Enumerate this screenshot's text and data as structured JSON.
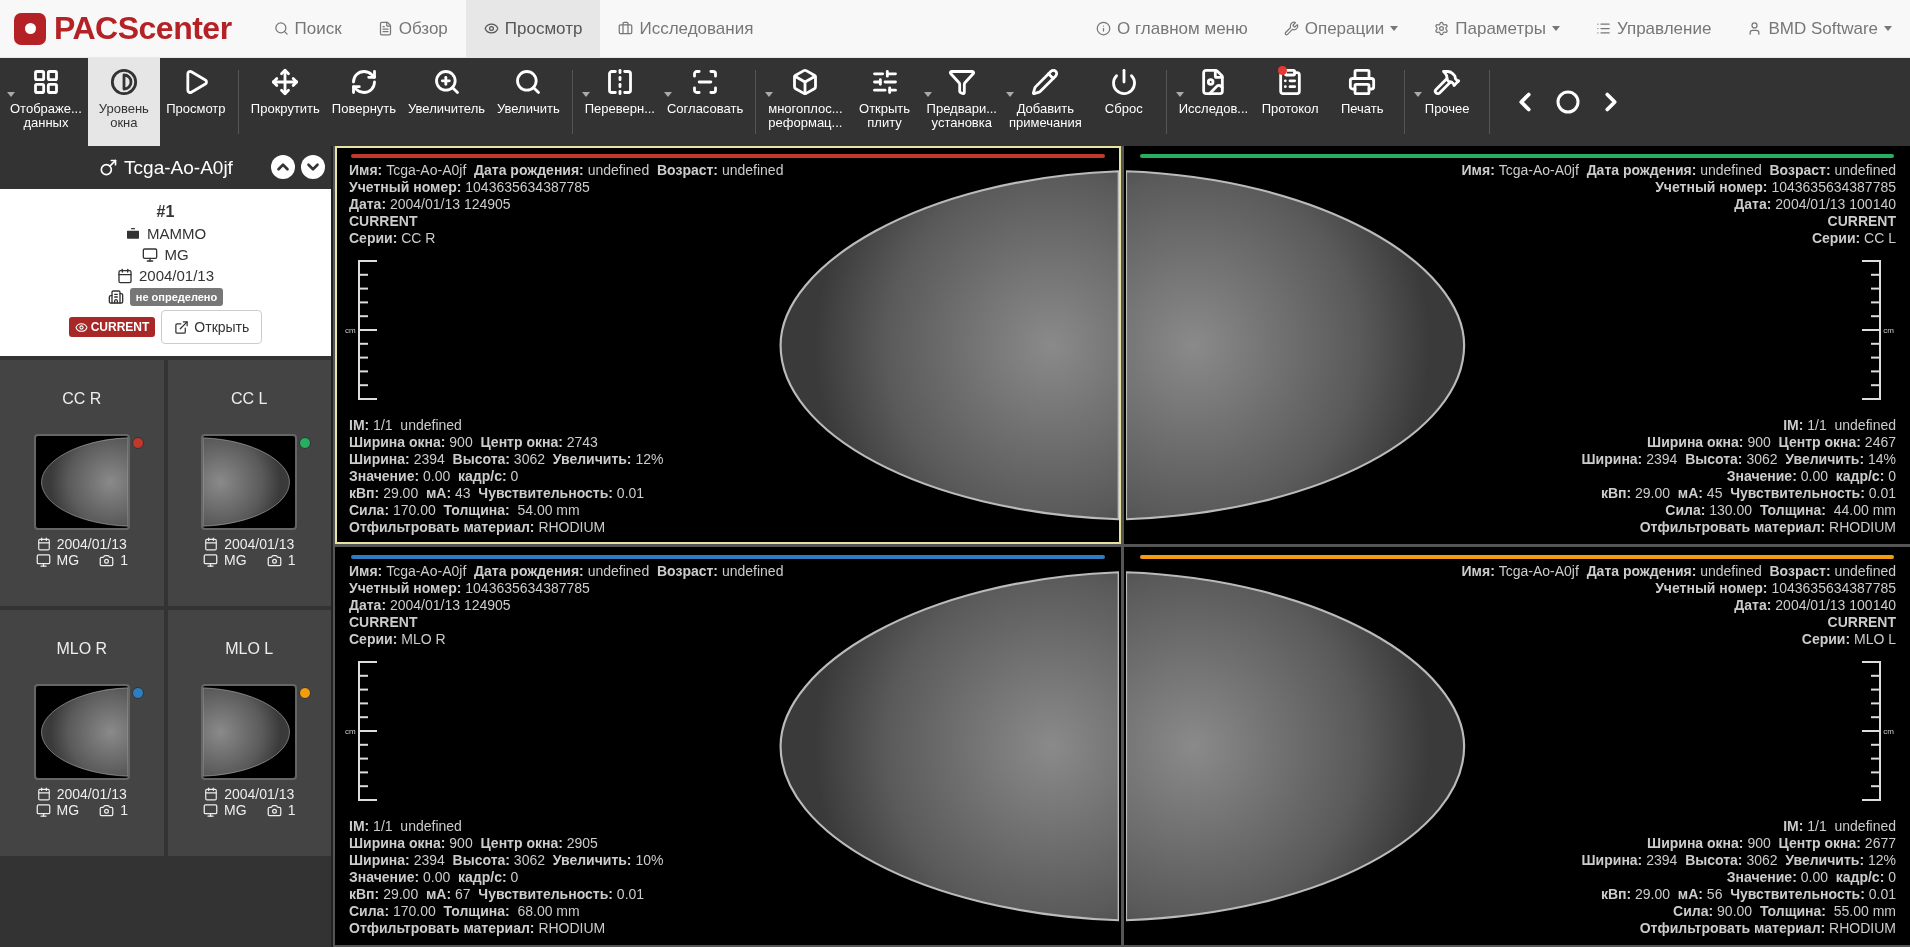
{
  "nav": {
    "logo": "PACScenter",
    "left": [
      {
        "label": "Поиск",
        "selected": false
      },
      {
        "label": "Обзор",
        "selected": false
      },
      {
        "label": "Просмотр",
        "selected": true
      },
      {
        "label": "Исследования",
        "selected": false
      }
    ],
    "right": [
      {
        "label": "О главном меню",
        "dropdown": false
      },
      {
        "label": "Операции",
        "dropdown": true
      },
      {
        "label": "Параметры",
        "dropdown": true
      },
      {
        "label": "Управление",
        "dropdown": false
      },
      {
        "label": "BMD Software",
        "dropdown": true
      }
    ]
  },
  "toolbar": {
    "groups": [
      [
        {
          "lines": [
            "Отображе...",
            "данных"
          ],
          "dropdown": true,
          "selected": false,
          "alert": false
        },
        {
          "lines": [
            "Уровень",
            "окна"
          ],
          "dropdown": false,
          "selected": true,
          "alert": false
        },
        {
          "lines": [
            "Просмотр"
          ],
          "dropdown": false,
          "selected": false,
          "alert": false
        }
      ],
      [
        {
          "lines": [
            "Прокрутить"
          ],
          "dropdown": false,
          "selected": false,
          "alert": false
        },
        {
          "lines": [
            "Повернуть"
          ],
          "dropdown": false,
          "selected": false,
          "alert": false
        },
        {
          "lines": [
            "Увеличитель"
          ],
          "dropdown": false,
          "selected": false,
          "alert": false
        },
        {
          "lines": [
            "Увеличить"
          ],
          "dropdown": false,
          "selected": false,
          "alert": false
        }
      ],
      [
        {
          "lines": [
            "Переверн..."
          ],
          "dropdown": true,
          "selected": false,
          "alert": false
        },
        {
          "lines": [
            "Согласовать"
          ],
          "dropdown": true,
          "selected": false,
          "alert": false
        }
      ],
      [
        {
          "lines": [
            "многоплос...",
            "реформац..."
          ],
          "dropdown": true,
          "selected": false,
          "alert": false
        },
        {
          "lines": [
            "Открыть",
            "плиту"
          ],
          "dropdown": false,
          "selected": false,
          "alert": false
        },
        {
          "lines": [
            "Предвари...",
            "установка"
          ],
          "dropdown": true,
          "selected": false,
          "alert": false
        },
        {
          "lines": [
            "Добавить",
            "примечания"
          ],
          "dropdown": true,
          "selected": false,
          "alert": false
        },
        {
          "lines": [
            "Сброс"
          ],
          "dropdown": false,
          "selected": false,
          "alert": false
        }
      ],
      [
        {
          "lines": [
            "Исследов..."
          ],
          "dropdown": true,
          "selected": false,
          "alert": false
        },
        {
          "lines": [
            "Протокол"
          ],
          "dropdown": false,
          "selected": false,
          "alert": true
        },
        {
          "lines": [
            "Печать"
          ],
          "dropdown": false,
          "selected": false,
          "alert": false
        }
      ],
      [
        {
          "lines": [
            "Прочее"
          ],
          "dropdown": true,
          "selected": false,
          "alert": false
        }
      ]
    ]
  },
  "patient": {
    "name": "Tcga-Ao-A0jf"
  },
  "study": {
    "number": "#1",
    "description": "MAMMO",
    "modality": "MG",
    "date": "2004/01/13",
    "institution": "не определено",
    "status": "CURRENT",
    "open_button": "Открыть"
  },
  "series": [
    {
      "title": "CC R",
      "color": "#c0392b",
      "date": "2004/01/13",
      "modality": "MG",
      "count": "1"
    },
    {
      "title": "CC L",
      "color": "#27ae60",
      "date": "2004/01/13",
      "modality": "MG",
      "count": "1"
    },
    {
      "title": "MLO R",
      "color": "#2e7dc0",
      "date": "2004/01/13",
      "modality": "MG",
      "count": "1"
    },
    {
      "title": "MLO L",
      "color": "#f39c12",
      "date": "2004/01/13",
      "modality": "MG",
      "count": "1"
    }
  ],
  "viewports": [
    {
      "selected": true,
      "color": "#c0392b",
      "ruler_unit": "cm",
      "top_lines": [
        "**Имя:** Tcga-Ao-A0jf  **Дата рождения:** undefined  **Возраст:** undefined",
        "**Учетный номер:** 1043635634387785",
        "**Дата:** 2004/01/13 124905",
        "**CURRENT**",
        "**Серии:** CC R"
      ],
      "bottom_lines": [
        "**IM:** 1/1  undefined",
        "**Ширина окна:** 900  **Центр окна:** 2743",
        "**Ширина:** 2394  **Высота:** 3062  **Увеличить:** 12%",
        "**Значение:** 0.00  **кадр/с:** 0",
        "**кВп:** 29.00  **мА:** 43  **Чувствительность:** 0.01",
        "**Сила:** 170.00  **Толщина:**  54.00 mm",
        "**Отфильтровать материал:** RHODIUM"
      ]
    },
    {
      "selected": false,
      "color": "#27ae60",
      "ruler_unit": "cm",
      "top_lines": [
        "**Имя:** Tcga-Ao-A0jf  **Дата рождения:** undefined  **Возраст:** undefined",
        "**Учетный номер:** 1043635634387785",
        "**Дата:** 2004/01/13 100140",
        "**CURRENT**",
        "**Серии:** CC L"
      ],
      "bottom_lines": [
        "**IM:** 1/1  undefined",
        "**Ширина окна:** 900  **Центр окна:** 2467",
        "**Ширина:** 2394  **Высота:** 3062  **Увеличить:** 14%",
        "**Значение:** 0.00  **кадр/с:** 0",
        "**кВп:** 29.00  **мА:** 45  **Чувствительность:** 0.01",
        "**Сила:** 130.00  **Толщина:**  44.00 mm",
        "**Отфильтровать материал:** RHODIUM"
      ]
    },
    {
      "selected": false,
      "color": "#2e7dc0",
      "ruler_unit": "cm",
      "top_lines": [
        "**Имя:** Tcga-Ao-A0jf  **Дата рождения:** undefined  **Возраст:** undefined",
        "**Учетный номер:** 1043635634387785",
        "**Дата:** 2004/01/13 124905",
        "**CURRENT**",
        "**Серии:** MLO R"
      ],
      "bottom_lines": [
        "**IM:** 1/1  undefined",
        "**Ширина окна:** 900  **Центр окна:** 2905",
        "**Ширина:** 2394  **Высота:** 3062  **Увеличить:** 10%",
        "**Значение:** 0.00  **кадр/с:** 0",
        "**кВп:** 29.00  **мА:** 67  **Чувствительность:** 0.01",
        "**Сила:** 170.00  **Толщина:**  68.00 mm",
        "**Отфильтровать материал:** RHODIUM"
      ]
    },
    {
      "selected": false,
      "color": "#f39c12",
      "ruler_unit": "cm",
      "top_lines": [
        "**Имя:** Tcga-Ao-A0jf  **Дата рождения:** undefined  **Возраст:** undefined",
        "**Учетный номер:** 1043635634387785",
        "**Дата:** 2004/01/13 100140",
        "**CURRENT**",
        "**Серии:** MLO L"
      ],
      "bottom_lines": [
        "**IM:** 1/1  undefined",
        "**Ширина окна:** 900  **Центр окна:** 2677",
        "**Ширина:** 2394  **Высота:** 3062  **Увеличить:** 12%",
        "**Значение:** 0.00  **кадр/с:** 0",
        "**кВп:** 29.00  **мА:** 56  **Чувствительность:** 0.01",
        "**Сила:** 90.00  **Толщина:**  55.00 mm",
        "**Отфильтровать материал:** RHODIUM"
      ]
    }
  ]
}
